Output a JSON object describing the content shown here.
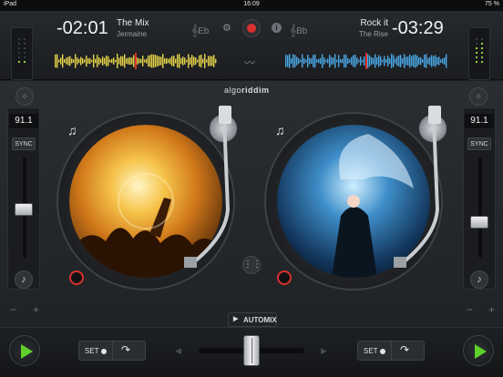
{
  "status": {
    "device": "iPad",
    "time": "16:09",
    "battery": "75 %"
  },
  "deck_a": {
    "time": "-02:01",
    "title": "The Mix",
    "artist": "Jermaine",
    "key": "Eb",
    "bpm": "91.1",
    "sync_label": "SYNC",
    "cue_label": "SET"
  },
  "deck_b": {
    "time": "-03:29",
    "title": "Rock it",
    "artist": "The Rise",
    "key": "Bb",
    "bpm": "91.1",
    "sync_label": "SYNC",
    "cue_label": "SET"
  },
  "brand": {
    "name_a": "algo",
    "name_b": "riddim"
  },
  "automix": {
    "label": "AUTOMIX"
  },
  "pitch": {
    "minus": "−",
    "plus": "+"
  },
  "colors": {
    "accent_green": "#5fd12a",
    "record_red": "#d93030",
    "wave_a": "#e6d54a",
    "wave_b": "#4aa8e6"
  },
  "icons": [
    "settings-icon",
    "record-icon",
    "info-icon",
    "waveform-icon",
    "music-note-icon",
    "grid-icon",
    "loop-arrow-icon",
    "play-icon",
    "sampler-icon"
  ]
}
